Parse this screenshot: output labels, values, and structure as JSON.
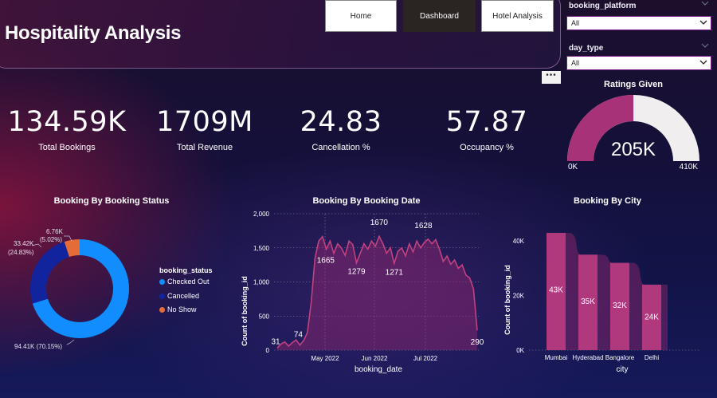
{
  "header": {
    "title": "Hospitality Analysis",
    "nav": {
      "home": "Home",
      "dashboard": "Dashboard",
      "hotel_analysis": "Hotel Analysis"
    }
  },
  "filters": {
    "booking_platform": {
      "label": "booking_platform",
      "value": "All"
    },
    "day_type": {
      "label": "day_type",
      "value": "All"
    }
  },
  "more_options": "•••",
  "kpis": [
    {
      "value": "134.59K",
      "label": "Total Bookings"
    },
    {
      "value": "1709M",
      "label": "Total Revenue"
    },
    {
      "value": "24.83",
      "label": "Cancellation %"
    },
    {
      "value": "57.87",
      "label": "Occupancy %"
    }
  ],
  "colors": {
    "checked_out": "#118dff",
    "cancelled": "#12239e",
    "no_show": "#e66c37",
    "gauge_fill": "#a83278",
    "gauge_track": "#f0eeee",
    "area_line": "#c2417f",
    "bar": "#b0397d"
  },
  "gauge": {
    "title": "Ratings Given",
    "value": "205K",
    "min": "0K",
    "max": "410K",
    "fraction": 0.5
  },
  "chart_data": [
    {
      "type": "pie",
      "title": "Booking By Booking Status",
      "legend_title": "booking_status",
      "categories": [
        "Checked Out",
        "Cancelled",
        "No Show"
      ],
      "values": [
        94410,
        33420,
        6760
      ],
      "labels": [
        "94.41K (70.15%)",
        "33.42K (24.83%)",
        "6.76K (5.02%)"
      ],
      "label_lines": {
        "checked_out": [
          "94.41K (70.15%)"
        ],
        "cancelled": [
          "33.42K",
          "(24.83%)"
        ],
        "no_show": [
          "6.76K",
          "(5.02%)"
        ]
      },
      "legend_placement": "right"
    },
    {
      "type": "area",
      "title": "Booking By Booking Date",
      "xlabel": "booking_date",
      "ylabel": "Count of booking_id",
      "ylim": [
        0,
        2000
      ],
      "yticks": [
        "0",
        "500",
        "1,000",
        "1,500",
        "2,000"
      ],
      "xticks": [
        "May 2022",
        "Jun 2022",
        "Jul 2022"
      ],
      "data_labels": [
        "31",
        "74",
        "1665",
        "1279",
        "1670",
        "1271",
        "1628",
        "290"
      ],
      "values": [
        31,
        90,
        120,
        60,
        110,
        150,
        74,
        140,
        260,
        700,
        1350,
        1600,
        1665,
        1480,
        1600,
        1420,
        1560,
        1500,
        1390,
        1600,
        1550,
        1279,
        1420,
        1560,
        1480,
        1600,
        1520,
        1670,
        1560,
        1420,
        1500,
        1271,
        1450,
        1500,
        1380,
        1560,
        1440,
        1600,
        1500,
        1580,
        1628,
        1560,
        1620,
        1480,
        1300,
        1380,
        1260,
        1320,
        1200,
        1250,
        1100,
        1060,
        900,
        290
      ]
    },
    {
      "type": "bar",
      "title": "Booking By City",
      "xlabel": "city",
      "ylabel": "Count of booking_id",
      "ylim": [
        0,
        50000
      ],
      "yticks": [
        "0K",
        "20K",
        "40K"
      ],
      "categories": [
        "Mumbai",
        "Hyderabad",
        "Bangalore",
        "Delhi"
      ],
      "values": [
        43000,
        35000,
        32000,
        24000
      ],
      "data_labels": [
        "43K",
        "35K",
        "32K",
        "24K"
      ]
    }
  ]
}
